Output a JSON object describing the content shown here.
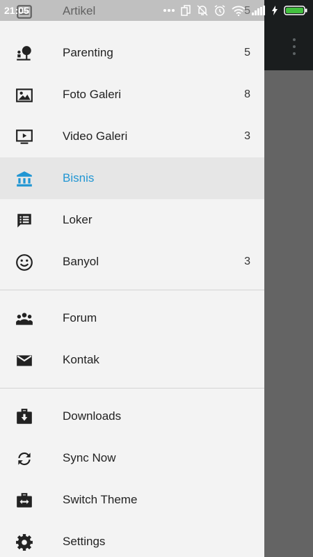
{
  "status_bar": {
    "time": "21:05",
    "icons": [
      "more-dots-icon",
      "copy-icon",
      "bell-off-icon",
      "alarm-icon",
      "wifi-icon",
      "signal-icon",
      "charging-icon",
      "battery-icon"
    ]
  },
  "drawer": {
    "top_item": {
      "label": "Artikel",
      "count": "5",
      "icon": "artikel-icon"
    },
    "group1": [
      {
        "label": "Parenting",
        "count": "5",
        "icon": "parenting-icon"
      },
      {
        "label": "Foto Galeri",
        "count": "8",
        "icon": "image-icon"
      },
      {
        "label": "Video Galeri",
        "count": "3",
        "icon": "video-icon"
      },
      {
        "label": "Bisnis",
        "count": "",
        "icon": "bank-icon",
        "active": true
      },
      {
        "label": "Loker",
        "count": "",
        "icon": "message-list-icon"
      },
      {
        "label": "Banyol",
        "count": "3",
        "icon": "smiley-icon"
      }
    ],
    "group2": [
      {
        "label": "Forum",
        "icon": "group-icon"
      },
      {
        "label": "Kontak",
        "icon": "mail-icon"
      }
    ],
    "group3": [
      {
        "label": "Downloads",
        "icon": "download-box-icon"
      },
      {
        "label": "Sync Now",
        "icon": "sync-icon"
      },
      {
        "label": "Switch Theme",
        "icon": "switch-theme-icon"
      },
      {
        "label": "Settings",
        "icon": "gear-icon"
      }
    ]
  },
  "colors": {
    "accent": "#2196d3",
    "drawer_bg": "#f3f3f3",
    "active_bg": "#e6e6e6",
    "appbar_bg": "#1a1d1e",
    "scrim": "#646464"
  }
}
